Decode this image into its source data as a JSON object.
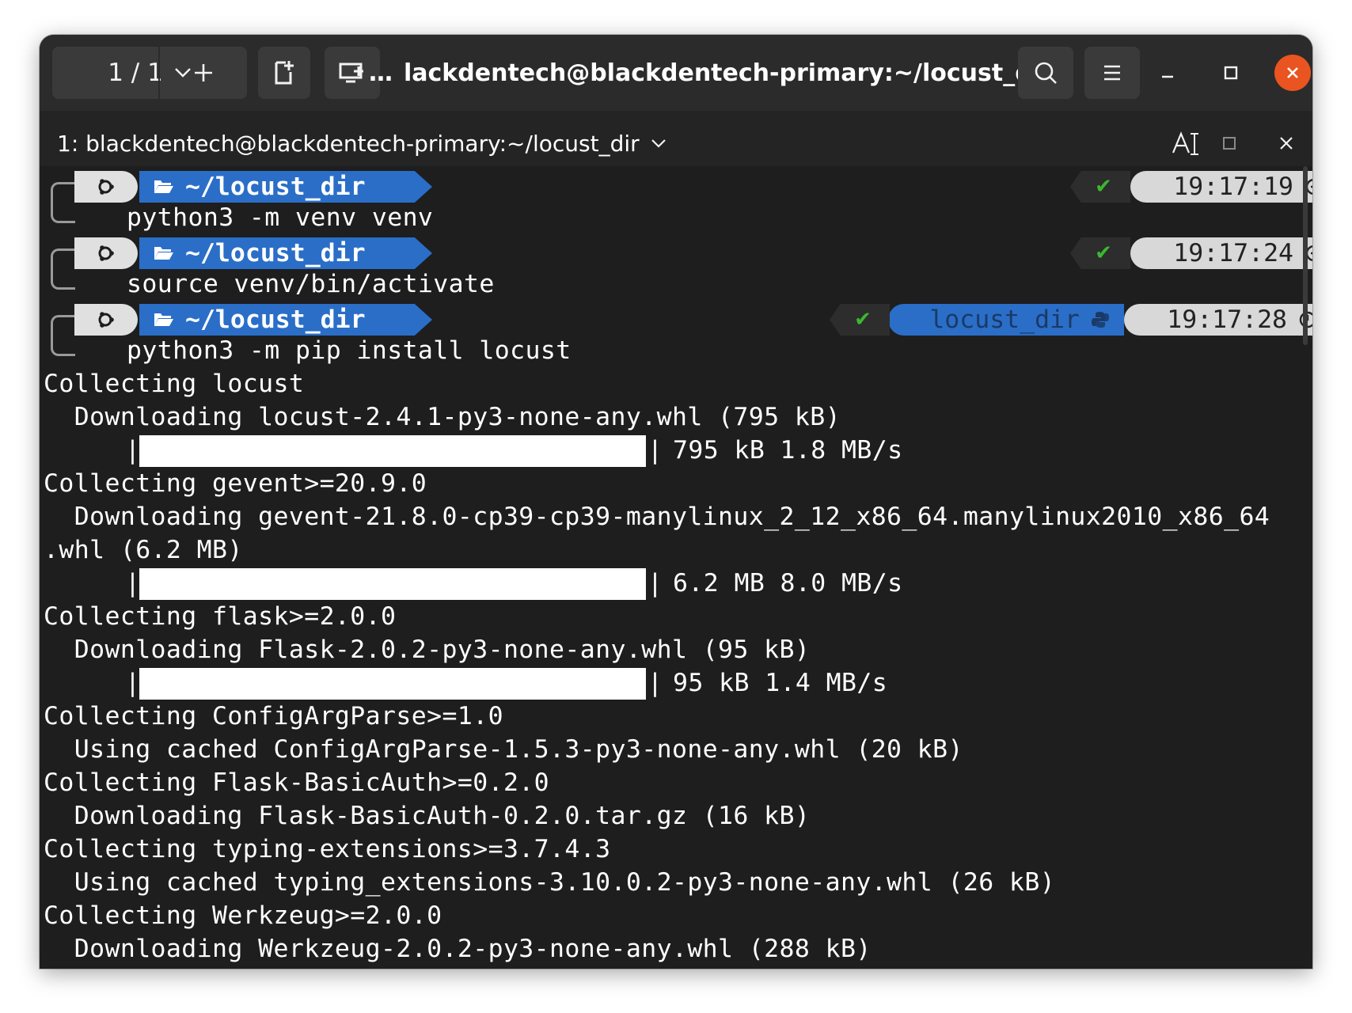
{
  "headerbar": {
    "tab_count": "1 / 1",
    "title_prefix": "…",
    "title": "lackdentech@blackdentech-primary:~/locust_dir"
  },
  "tab": {
    "label": "1: blackdentech@blackdentech-primary:~/locust_dir"
  },
  "prompts": [
    {
      "dir": "~/locust_dir",
      "command": "python3 -m venv venv",
      "status": "✔",
      "time": "19:17:19"
    },
    {
      "dir": "~/locust_dir",
      "command": "source venv/bin/activate",
      "status": "✔",
      "time": "19:17:24"
    },
    {
      "dir": "~/locust_dir",
      "command": "python3 -m pip install locust",
      "status": "✔",
      "env": "locust_dir",
      "time": "19:17:28"
    }
  ],
  "output": [
    "Collecting locust",
    "  Downloading locust-2.4.1-py3-none-any.whl (795 kB)",
    "795 kB 1.8 MB/s",
    "Collecting gevent>=20.9.0",
    "  Downloading gevent-21.8.0-cp39-cp39-manylinux_2_12_x86_64.manylinux2010_x86_64",
    ".whl (6.2 MB)",
    "6.2 MB 8.0 MB/s",
    "Collecting flask>=2.0.0",
    "  Downloading Flask-2.0.2-py3-none-any.whl (95 kB)",
    "95 kB 1.4 MB/s",
    "Collecting ConfigArgParse>=1.0",
    "  Using cached ConfigArgParse-1.5.3-py3-none-any.whl (20 kB)",
    "Collecting Flask-BasicAuth>=0.2.0",
    "  Downloading Flask-BasicAuth-0.2.0.tar.gz (16 kB)",
    "Collecting typing-extensions>=3.7.4.3",
    "  Using cached typing_extensions-3.10.0.2-py3-none-any.whl (26 kB)",
    "Collecting Werkzeug>=2.0.0",
    "  Downloading Werkzeug-2.0.2-py3-none-any.whl (288 kB)"
  ],
  "progress": [
    1.0,
    1.0,
    1.0
  ],
  "pipe": "|",
  "icons": {
    "tabs_dropdown": "chevron-down-icon",
    "new_tab": "plus-icon",
    "split": "new-window-icon",
    "cast": "monitor-add-icon",
    "search": "search-icon",
    "menu": "hamburger-icon",
    "minimize": "minimize-icon",
    "maximize": "maximize-icon",
    "close": "close-icon",
    "font": "font-size-icon",
    "tab_max": "tab-maximize-icon",
    "tab_close": "tab-close-icon",
    "os": "ubuntu-icon",
    "folder": "folder-open-icon",
    "python": "python-icon",
    "clock": "clock-icon"
  },
  "colors": {
    "accent": "#e95420",
    "dir_segment": "#2a6ec8",
    "ok": "#3cb82f"
  }
}
